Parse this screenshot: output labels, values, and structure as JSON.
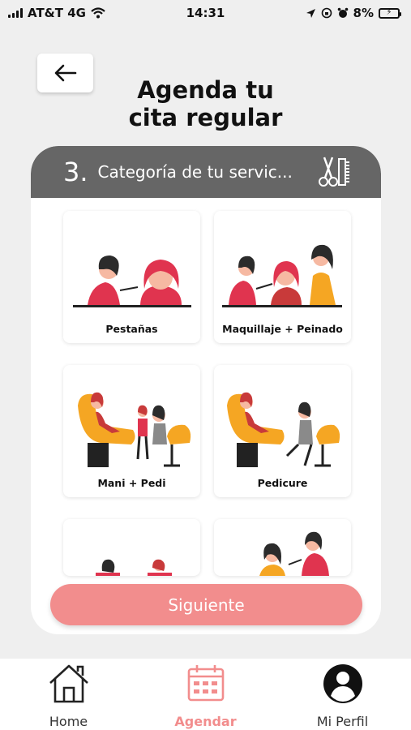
{
  "status_bar": {
    "carrier": "AT&T 4G",
    "time": "14:31",
    "battery": "8%"
  },
  "page": {
    "title": "Agenda tu\ncita regular"
  },
  "step": {
    "number": "3.",
    "label": "Categoría de tu servic..."
  },
  "categories": [
    {
      "label": "Pestañas"
    },
    {
      "label": "Maquillaje + Peinado"
    },
    {
      "label": "Mani + Pedi"
    },
    {
      "label": "Pedicure"
    },
    {
      "label": ""
    },
    {
      "label": ""
    }
  ],
  "actions": {
    "next_label": "Siguiente"
  },
  "nav": {
    "items": [
      {
        "label": "Home",
        "icon": "home-icon"
      },
      {
        "label": "Agendar",
        "icon": "calendar-icon"
      },
      {
        "label": "Mi Perfil",
        "icon": "profile-icon"
      }
    ]
  },
  "colors": {
    "accent": "#f28d8d",
    "header": "#666666",
    "background": "#efefef"
  }
}
